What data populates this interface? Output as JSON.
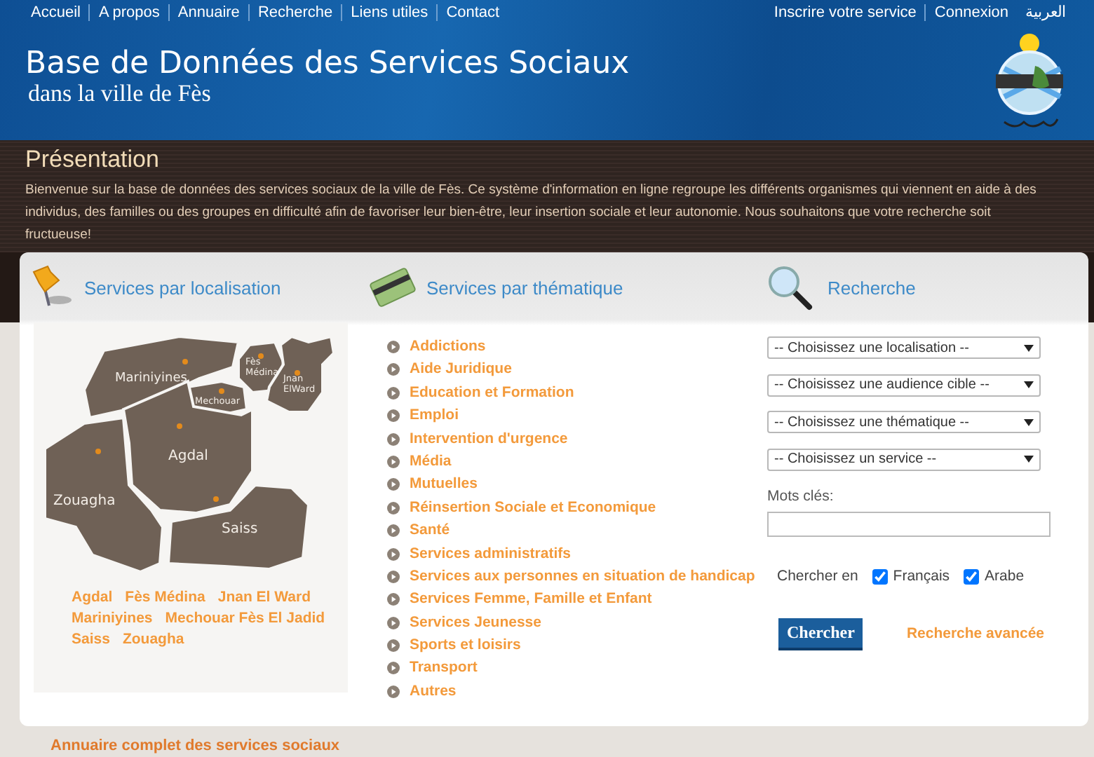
{
  "nav": {
    "left": [
      "Accueil",
      "A propos",
      "Annuaire",
      "Recherche",
      "Liens utiles",
      "Contact"
    ],
    "right": [
      "Inscrire votre service",
      "Connexion",
      "العربية"
    ]
  },
  "header": {
    "title": "Base de Données des Services Sociaux",
    "subtitle": "dans la ville de Fès"
  },
  "presentation": {
    "title": "Présentation",
    "text": "Bienvenue sur la base de données des services sociaux de la ville de Fès. Ce système d'information en ligne regroupe les différents organismes qui viennent en aide à des individus, des familles ou des groupes en difficulté afin de favoriser leur bien-être, leur insertion sociale et leur autonomie. Nous souhaitons que votre recherche soit fructueuse!"
  },
  "localisation": {
    "title": "Services par localisation",
    "regions": [
      {
        "lines": [
          "Mariniyines"
        ]
      },
      {
        "lines": [
          "Fès",
          "Médina"
        ]
      },
      {
        "lines": [
          "Mechouar"
        ]
      },
      {
        "lines": [
          "Jnan",
          "ElWard"
        ]
      },
      {
        "lines": [
          "Agdal"
        ]
      },
      {
        "lines": [
          "Zouagha"
        ]
      },
      {
        "lines": [
          "Saiss"
        ]
      }
    ],
    "links": [
      "Agdal",
      "Fès Médina",
      "Jnan El Ward",
      "Mariniyines",
      "Mechouar Fès El Jadid",
      "Saiss",
      "Zouagha"
    ]
  },
  "thematique": {
    "title": "Services par thématique",
    "items": [
      "Addictions",
      "Aide Juridique",
      "Education et Formation",
      "Emploi",
      "Intervention d'urgence",
      "Média",
      "Mutuelles",
      "Réinsertion Sociale et Economique",
      "Santé",
      "Services administratifs",
      "Services aux personnes en situation de handicap",
      "Services Femme, Famille et Enfant",
      "Services Jeunesse",
      "Sports et loisirs",
      "Transport",
      "Autres"
    ]
  },
  "recherche": {
    "title": "Recherche",
    "selects": [
      "-- Choisissez une localisation --",
      "-- Choisissez une audience cible --",
      "-- Choisissez une thématique --",
      "-- Choisissez un service --"
    ],
    "keywords_label": "Mots clés:",
    "search_in": {
      "label": "Chercher en",
      "options": [
        {
          "label": "Français",
          "checked": true
        },
        {
          "label": "Arabe",
          "checked": true
        }
      ]
    },
    "button": "Chercher",
    "advanced_link": "Recherche avancée"
  },
  "footer_link": "Annuaire complet des services sociaux"
}
